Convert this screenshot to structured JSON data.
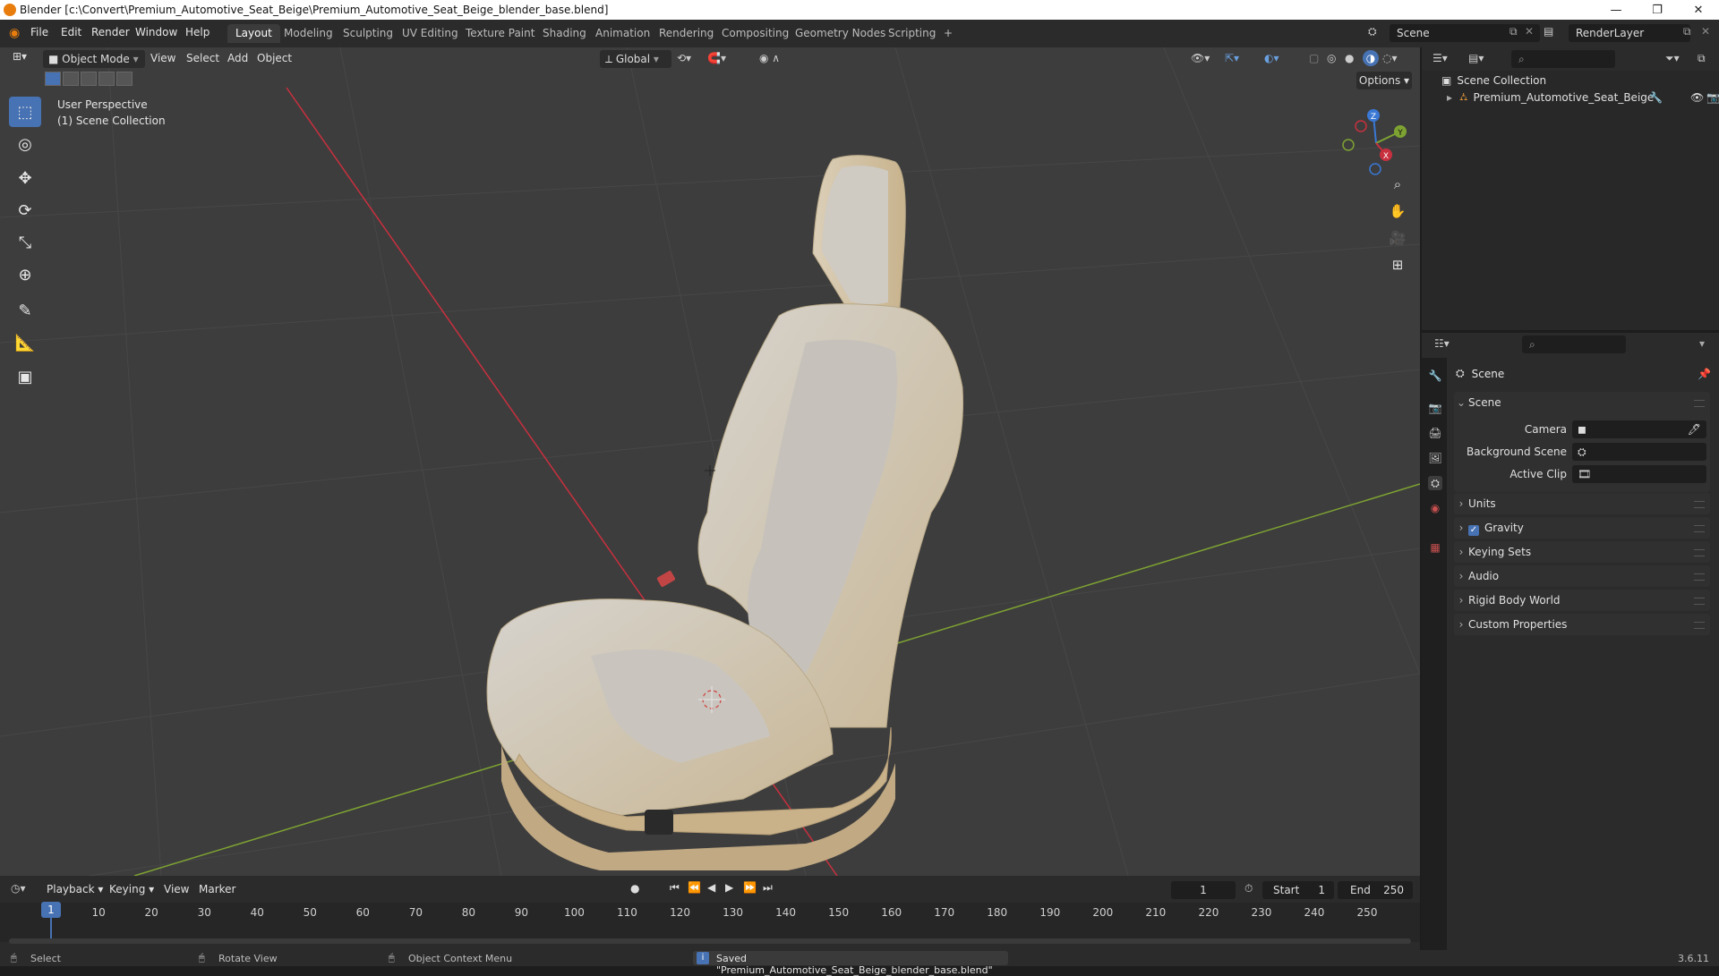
{
  "window": {
    "title": "Blender [c:\\Convert\\Premium_Automotive_Seat_Beige\\Premium_Automotive_Seat_Beige_blender_base.blend]",
    "minimize": "—",
    "maximize": "❐",
    "close": "✕"
  },
  "menu": [
    "File",
    "Edit",
    "Render",
    "Window",
    "Help"
  ],
  "workspaces": [
    "Layout",
    "Modeling",
    "Sculpting",
    "UV Editing",
    "Texture Paint",
    "Shading",
    "Animation",
    "Rendering",
    "Compositing",
    "Geometry Nodes",
    "Scripting"
  ],
  "workspace_add": "+",
  "scene_field": "Scene",
  "renderlayer_field": "RenderLayer",
  "viewport": {
    "mode": "Object Mode",
    "menus": [
      "View",
      "Select",
      "Add",
      "Object"
    ],
    "orientation": "Global",
    "options": "Options",
    "perspective_label": "User Perspective",
    "collection_label": "(1) Scene Collection",
    "gizmo": {
      "x": "X",
      "y": "Y",
      "z": "Z"
    }
  },
  "tools": [
    {
      "name": "select-box",
      "glyph": "⬚"
    },
    {
      "name": "cursor",
      "glyph": "◎"
    },
    {
      "name": "move",
      "glyph": "✥"
    },
    {
      "name": "rotate",
      "glyph": "⟳"
    },
    {
      "name": "scale",
      "glyph": "⤡"
    },
    {
      "name": "transform",
      "glyph": "⊕"
    },
    {
      "name": "annotate",
      "glyph": "✎"
    },
    {
      "name": "measure",
      "glyph": "📐"
    },
    {
      "name": "add-cube",
      "glyph": "▣"
    }
  ],
  "outliner": {
    "root": "Scene Collection",
    "items": [
      {
        "label": "Premium_Automotive_Seat_Beige"
      }
    ]
  },
  "properties": {
    "header": "Scene",
    "scene_panel": {
      "title": "Scene",
      "fields": [
        {
          "label": "Camera"
        },
        {
          "label": "Background Scene"
        },
        {
          "label": "Active Clip"
        }
      ]
    },
    "panels": [
      {
        "label": "Units",
        "checkbox": false
      },
      {
        "label": "Gravity",
        "checkbox": true
      },
      {
        "label": "Keying Sets",
        "checkbox": false
      },
      {
        "label": "Audio",
        "checkbox": false
      },
      {
        "label": "Rigid Body World",
        "checkbox": false
      },
      {
        "label": "Custom Properties",
        "checkbox": false
      }
    ]
  },
  "timeline": {
    "menus": [
      "Playback",
      "Keying",
      "View",
      "Marker"
    ],
    "current_frame": "1",
    "start_label": "Start",
    "start_value": "1",
    "end_label": "End",
    "end_value": "250",
    "ticks": [
      "1",
      "10",
      "20",
      "30",
      "40",
      "50",
      "60",
      "70",
      "80",
      "90",
      "100",
      "110",
      "120",
      "130",
      "140",
      "150",
      "160",
      "170",
      "180",
      "190",
      "200",
      "210",
      "220",
      "230",
      "240",
      "250"
    ]
  },
  "status": {
    "select": "Select",
    "rotate": "Rotate View",
    "context": "Object Context Menu",
    "message": "Saved \"Premium_Automotive_Seat_Beige_blender_base.blend\"",
    "version": "3.6.11"
  },
  "colors": {
    "accent": "#4772b3",
    "x_axis": "#c8303e",
    "y_axis": "#7ea332",
    "z_axis": "#3a78d4",
    "seat": "#d7c6a6"
  }
}
